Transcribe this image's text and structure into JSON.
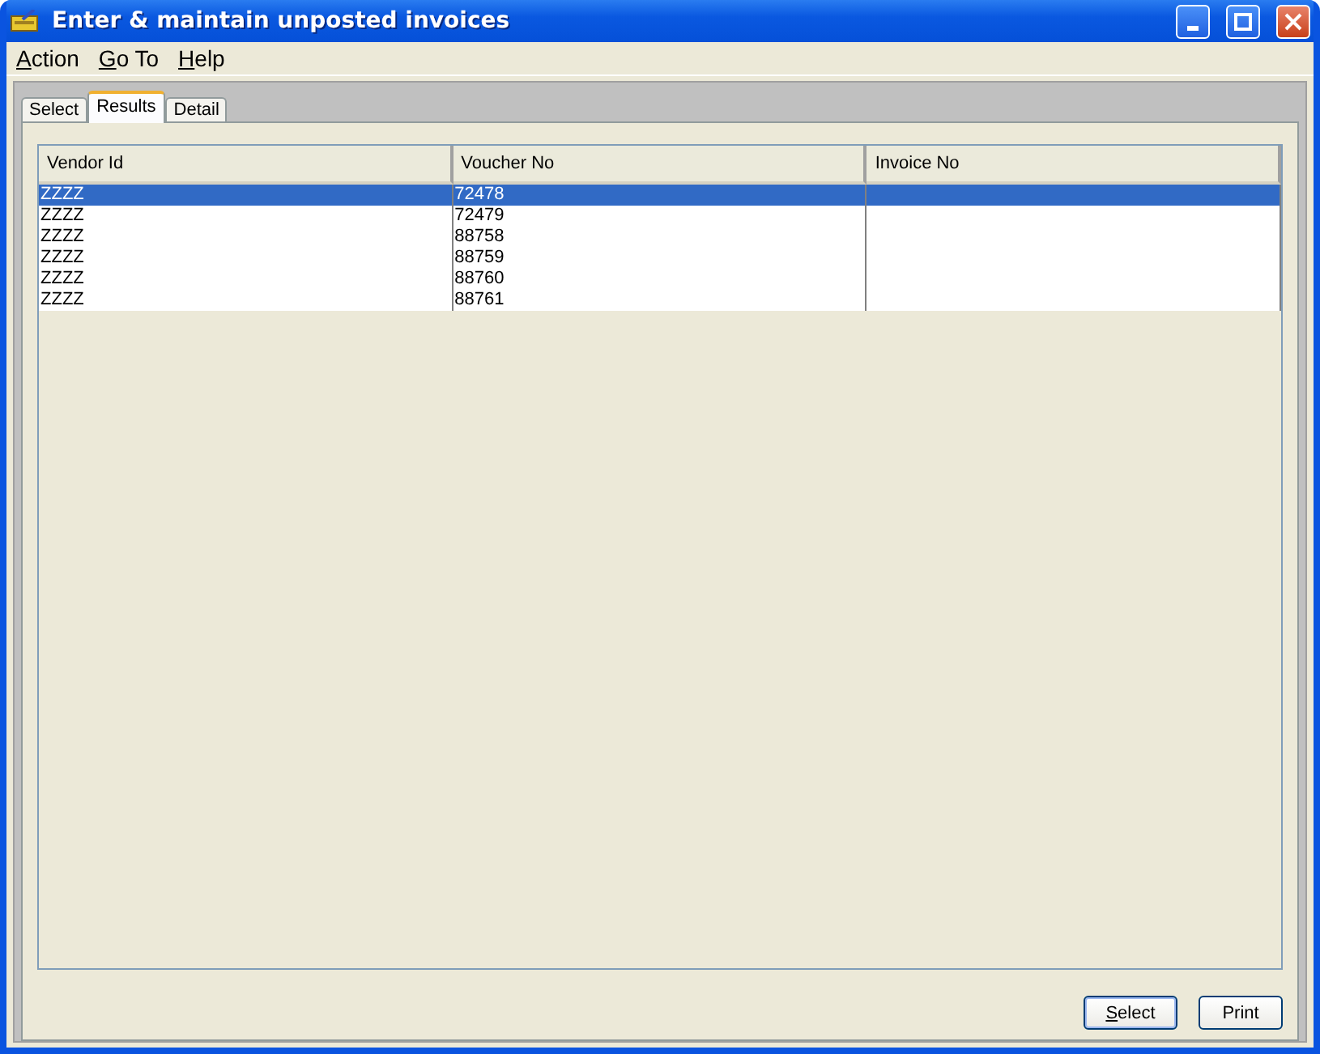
{
  "window": {
    "title": "Enter & maintain unposted invoices"
  },
  "menu": [
    {
      "label": "Action",
      "underline_first": true
    },
    {
      "label": "Go To",
      "underline_first": true
    },
    {
      "label": "Help",
      "underline_first": true
    }
  ],
  "tabs": [
    {
      "label": "Select",
      "selected": false
    },
    {
      "label": "Results",
      "selected": true
    },
    {
      "label": "Detail",
      "selected": false
    }
  ],
  "table": {
    "columns": [
      "Vendor Id",
      "Voucher No",
      "Invoice No"
    ],
    "rows": [
      {
        "cells": [
          "ZZZZ",
          "72478",
          ""
        ],
        "selected": true
      },
      {
        "cells": [
          "ZZZZ",
          "72479",
          ""
        ],
        "selected": false
      },
      {
        "cells": [
          "ZZZZ",
          "88758",
          ""
        ],
        "selected": false
      },
      {
        "cells": [
          "ZZZZ",
          "88759",
          ""
        ],
        "selected": false
      },
      {
        "cells": [
          "ZZZZ",
          "88760",
          ""
        ],
        "selected": false
      },
      {
        "cells": [
          "ZZZZ",
          "88761",
          ""
        ],
        "selected": false
      }
    ]
  },
  "buttons": [
    {
      "label": "Select",
      "underline_first": true,
      "default": true
    },
    {
      "label": "Print",
      "underline_first": false,
      "default": false
    }
  ]
}
